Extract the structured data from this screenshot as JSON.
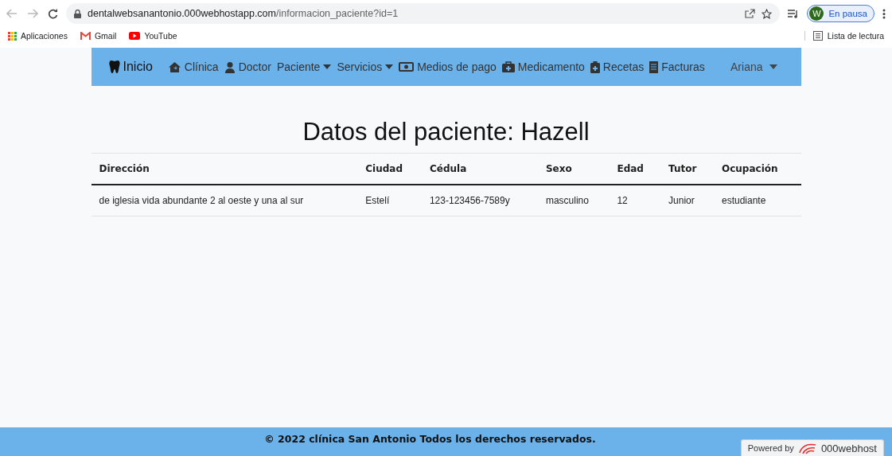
{
  "browser": {
    "url_host": "dentalwebsanantonio.000webhostapp.com",
    "url_path": "/informacion_paciente?id=1",
    "profile_initial": "W",
    "profile_status": "En pausa",
    "bookmarks": [
      "Aplicaciones",
      "Gmail",
      "YouTube"
    ],
    "reading_list": "Lista de lectura"
  },
  "navbar": {
    "brand": "Inicio",
    "items": [
      {
        "label": "Clínica",
        "dropdown": false
      },
      {
        "label": "Doctor",
        "dropdown": false
      },
      {
        "label": "Paciente",
        "dropdown": true
      },
      {
        "label": "Servicios",
        "dropdown": true
      },
      {
        "label": "Medios de pago",
        "dropdown": false
      },
      {
        "label": "Medicamento",
        "dropdown": false
      },
      {
        "label": "Recetas",
        "dropdown": false
      },
      {
        "label": "Facturas",
        "dropdown": false
      }
    ],
    "user": {
      "label": "Ariana",
      "dropdown": true
    }
  },
  "title": "Datos del paciente: Hazell",
  "table": {
    "columns": [
      "Dirección",
      "Ciudad",
      "Cédula",
      "Sexo",
      "Edad",
      "Tutor",
      "Ocupación"
    ],
    "rows": [
      [
        "de iglesia vida abundante 2 al oeste y una al sur",
        "Estelí",
        "123-123456-7589y",
        "masculino",
        "12",
        "Junior",
        "estudiante"
      ]
    ]
  },
  "footer": {
    "text": "© 2022 clínica San Antonio Todos los derechos reservados.",
    "powered_by": "Powered by",
    "host": "000webhost"
  }
}
